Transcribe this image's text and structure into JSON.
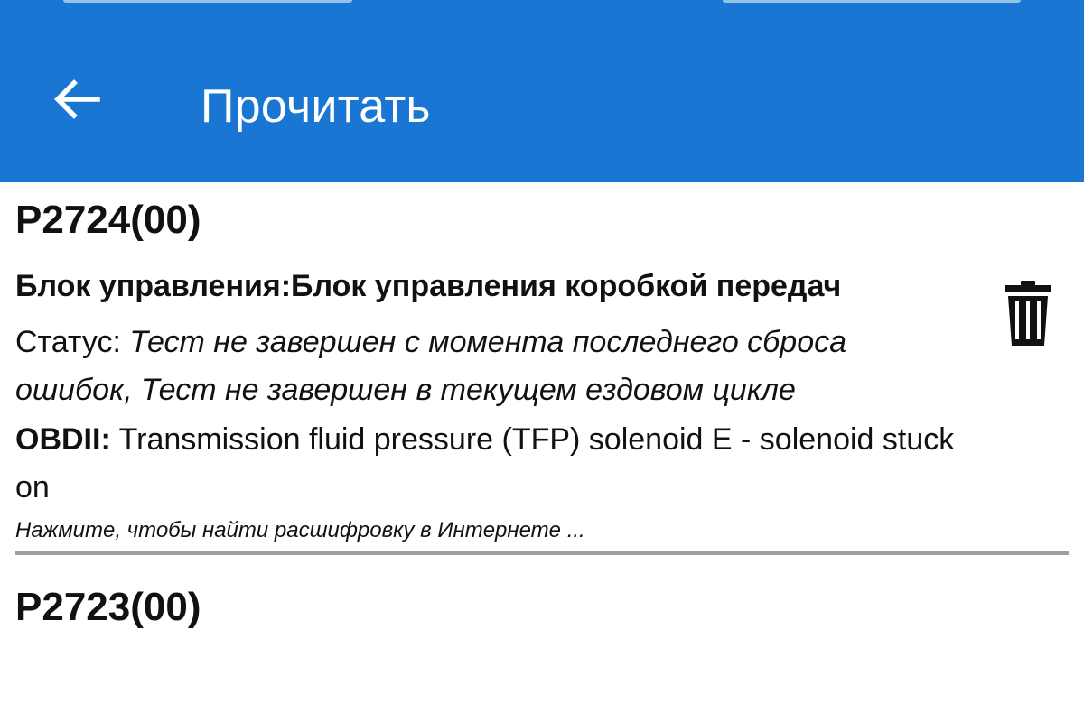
{
  "toolbar": {
    "title": "Прочитать",
    "back_icon": "arrow-back-icon",
    "background_color": "#1976d2"
  },
  "dtc_list": [
    {
      "code": "P2724(00)",
      "module": "Блок управления:Блок управления коробкой передач",
      "status_label": "Статус: ",
      "status_value": "Тест не завершен с момента последнего сброса ошибок, Тест не завершен в текущем ездовом цикле",
      "obd_label": "OBDII:",
      "obd_description": " Transmission fluid pressure (TFP) solenoid E - solenoid stuck on",
      "search_link": "Нажмите, чтобы найти расшифровку в Интернете ...",
      "delete_icon": "trash-icon"
    },
    {
      "code": "P2723(00)"
    }
  ]
}
